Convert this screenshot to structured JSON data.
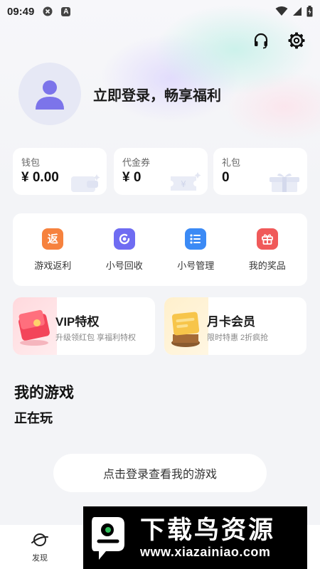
{
  "status_bar": {
    "time": "09:49",
    "badge_letter": "A"
  },
  "profile": {
    "login_prompt": "立即登录，畅享福利"
  },
  "wallet": [
    {
      "label": "钱包",
      "value": "¥ 0.00"
    },
    {
      "label": "代金券",
      "value": "¥ 0"
    },
    {
      "label": "礼包",
      "value": "0"
    }
  ],
  "actions": [
    {
      "label": "游戏返利",
      "icon_text": "返",
      "icon": "rebate-icon",
      "color": "#f6823e"
    },
    {
      "label": "小号回收",
      "icon": "recycle-icon",
      "color": "#6f6cf2"
    },
    {
      "label": "小号管理",
      "icon": "list-icon",
      "color": "#3b8af5"
    },
    {
      "label": "我的奖品",
      "icon": "gift-icon",
      "color": "#f05a5a"
    }
  ],
  "promos": [
    {
      "title": "VIP特权",
      "subtitle": "升级领红包 享福利特权"
    },
    {
      "title": "月卡会员",
      "subtitle": "限时特惠  2折疯抢"
    }
  ],
  "my_games": {
    "title": "我的游戏",
    "playing": "正在玩",
    "login_button": "点击登录查看我的游戏"
  },
  "bottom_nav": {
    "discover": "发现"
  },
  "watermark": {
    "title": "下载鸟资源",
    "url": "www.xiazainiao.com"
  }
}
